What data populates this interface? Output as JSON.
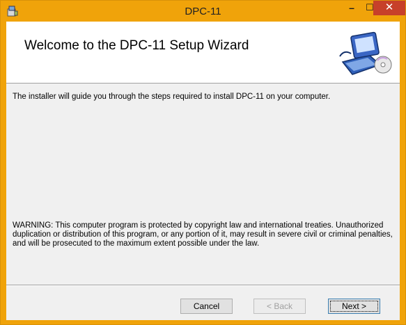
{
  "window": {
    "title": "DPC-11"
  },
  "titlebar": {
    "minimize_glyph": "–",
    "maximize_glyph": "☐",
    "close_glyph": "✕"
  },
  "banner": {
    "title": "Welcome to the DPC-11 Setup Wizard",
    "art_icon": "computer-cd-icon"
  },
  "body": {
    "intro": "The installer will guide you through the steps required to install DPC-11 on your computer.",
    "warning": "WARNING: This computer program is protected by copyright law and international treaties. Unauthorized duplication or distribution of this program, or any portion of it, may result in severe civil or criminal penalties, and will be prosecuted to the maximum extent possible under the law."
  },
  "buttons": {
    "cancel": "Cancel",
    "back": "< Back",
    "next": "Next >"
  },
  "colors": {
    "titlebar": "#f0a30a",
    "close": "#c7402a"
  }
}
